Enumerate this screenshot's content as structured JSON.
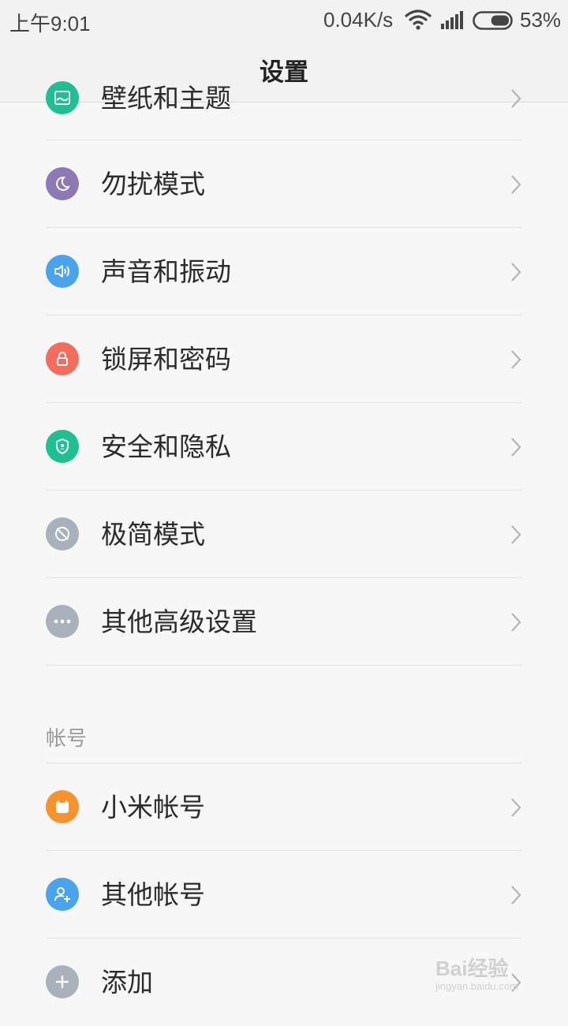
{
  "status_bar": {
    "time": "上午9:01",
    "speed": "0.04K/s",
    "battery_pct": "53%",
    "battery_level": 0.53
  },
  "title": "设置",
  "items": [
    {
      "label": "壁纸和主题",
      "icon": "wallpaper-icon",
      "color": "#1fbf94"
    },
    {
      "label": "勿扰模式",
      "icon": "moon-icon",
      "color": "#8c79b5"
    },
    {
      "label": "声音和振动",
      "icon": "speaker-icon",
      "color": "#4aa3ee"
    },
    {
      "label": "锁屏和密码",
      "icon": "lock-icon",
      "color": "#f36d5d"
    },
    {
      "label": "安全和隐私",
      "icon": "shield-icon",
      "color": "#1fbf94"
    },
    {
      "label": "极简模式",
      "icon": "minimal-mode-icon",
      "color": "#a8b1bc"
    },
    {
      "label": "其他高级设置",
      "icon": "more-icon",
      "color": "#a8b1bc"
    }
  ],
  "account_section": {
    "header": "帐号",
    "items": [
      {
        "label": "小米帐号",
        "icon": "mi-account-icon",
        "color": "#f7922d"
      },
      {
        "label": "其他帐号",
        "icon": "add-user-icon",
        "color": "#4aa3ee"
      },
      {
        "label": "添加",
        "icon": "add-icon",
        "color": "#a8b1bc"
      }
    ]
  },
  "watermark": {
    "text": "Bai经验",
    "url": "jingyan.baidu.com"
  }
}
